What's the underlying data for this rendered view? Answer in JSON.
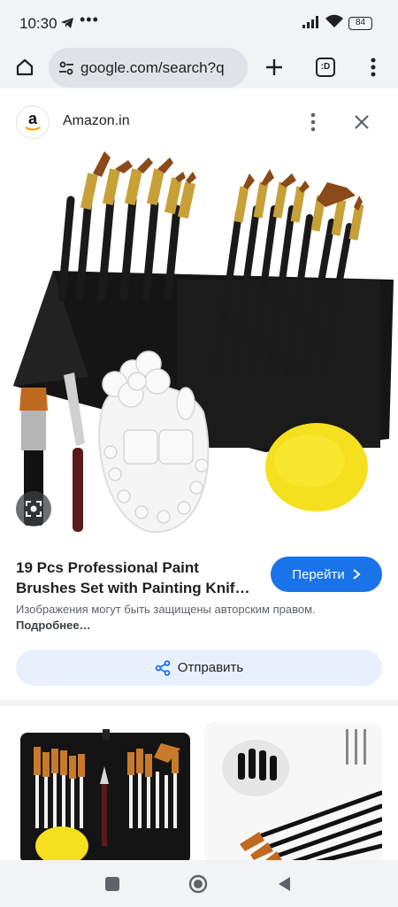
{
  "status_bar": {
    "time": "10:30",
    "overflow_dots": "•••",
    "battery": "84"
  },
  "browser": {
    "url": "google.com/search?q",
    "tab_count_label": ":D"
  },
  "result": {
    "site_name": "Amazon.in",
    "site_logo_letter": "a",
    "title_line1": "19 Pcs Professional Paint",
    "title_line2": "Brushes Set with Painting Knif…",
    "visit_label": "Перейти",
    "copyright_text": "Изображения могут быть защищены авторским правом.",
    "copyright_more": "Подробнее…",
    "share_label": "Отправить"
  },
  "icons": {
    "home": "home-icon",
    "tune": "site-settings-icon",
    "new_tab": "plus-icon",
    "menu": "more-vert-icon",
    "close": "close-icon",
    "visit": "chevron-right-icon",
    "share": "share-icon",
    "lens": "lens-icon"
  },
  "colors": {
    "accent": "#1a73e8",
    "share_bg": "#e8f0fe",
    "chrome_bg": "#f1f3f4"
  }
}
